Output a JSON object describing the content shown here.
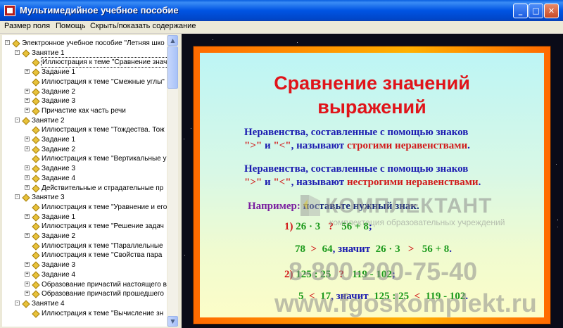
{
  "window": {
    "title": "Мультимедийное учебное пособие",
    "controls": {
      "minimize": "_",
      "maximize": "□",
      "close": "✕"
    }
  },
  "menu": [
    "Размер поля",
    "Помощь",
    "Скрыть/показать содержание"
  ],
  "tree": [
    {
      "level": 0,
      "expander": "-",
      "label": "Электронное учебное пособие \"Летняя шко"
    },
    {
      "level": 1,
      "expander": "-",
      "label": "Занятие 1"
    },
    {
      "level": 2,
      "expander": "",
      "label": "Иллюстрация к теме \"Сравнение знач",
      "selected": true
    },
    {
      "level": 2,
      "expander": "+",
      "label": "Задание 1"
    },
    {
      "level": 2,
      "expander": "",
      "label": "Иллюстрация к теме \"Смежные углы\""
    },
    {
      "level": 2,
      "expander": "+",
      "label": "Задание 2"
    },
    {
      "level": 2,
      "expander": "+",
      "label": "Задание 3"
    },
    {
      "level": 2,
      "expander": "+",
      "label": "Причастие как часть речи"
    },
    {
      "level": 1,
      "expander": "-",
      "label": "Занятие 2"
    },
    {
      "level": 2,
      "expander": "",
      "label": "Иллюстрация к теме \"Тождества. Тож"
    },
    {
      "level": 2,
      "expander": "+",
      "label": "Задание 1"
    },
    {
      "level": 2,
      "expander": "+",
      "label": "Задание 2"
    },
    {
      "level": 2,
      "expander": "",
      "label": "Иллюстрация к теме \"Вертикальные у"
    },
    {
      "level": 2,
      "expander": "+",
      "label": "Задание 3"
    },
    {
      "level": 2,
      "expander": "+",
      "label": "Задание 4"
    },
    {
      "level": 2,
      "expander": "+",
      "label": "Действительные и страдательные пр"
    },
    {
      "level": 1,
      "expander": "-",
      "label": "Занятие 3"
    },
    {
      "level": 2,
      "expander": "",
      "label": "Иллюстрация к теме \"Уравнение и его"
    },
    {
      "level": 2,
      "expander": "+",
      "label": "Задание 1"
    },
    {
      "level": 2,
      "expander": "",
      "label": "Иллюстрация к теме \"Решение задач"
    },
    {
      "level": 2,
      "expander": "+",
      "label": "Задание 2"
    },
    {
      "level": 2,
      "expander": "",
      "label": "Иллюстрация к теме \"Параллельные"
    },
    {
      "level": 2,
      "expander": "",
      "label": "Иллюстрация к теме \"Свойства пара"
    },
    {
      "level": 2,
      "expander": "+",
      "label": "Задание 3"
    },
    {
      "level": 2,
      "expander": "+",
      "label": "Задание 4"
    },
    {
      "level": 2,
      "expander": "+",
      "label": "Образование причастий настоящего в"
    },
    {
      "level": 2,
      "expander": "+",
      "label": "Образование причастий прошедшего"
    },
    {
      "level": 1,
      "expander": "-",
      "label": "Занятие 4"
    },
    {
      "level": 2,
      "expander": "",
      "label": "Иллюстрация к теме \"Вычисление зн"
    }
  ],
  "slide": {
    "title_line1": "Сравнение значений",
    "title_line2": "выражений",
    "p1_line1": "Неравенства, составленные с помощью знаков",
    "p1_gt": "\">\"",
    "p1_and": " и ",
    "p1_lt": "\"<\"",
    "p1_called": ", называют ",
    "p1_term": "строгими неравенствами",
    "p1_dot": ".",
    "p2_line1": "Неравенства, составленные с помощью знаков",
    "p2_ge": "\">\"",
    "p2_and": " и ",
    "p2_le": "\"<\"",
    "p2_called": ", называют ",
    "p2_term": "нестрогими неравенствами",
    "p2_dot": ".",
    "example_label": "Например:",
    "example_text": "поставьте нужный знак.",
    "ex1_num": "1)",
    "ex1_a": "26 · 3",
    "ex1_q": "?",
    "ex1_b": "56 + 8",
    "ex1_semi": ";",
    "ex1_ans_a": "78",
    "ex1_ans_sign": ">",
    "ex1_ans_b": "64",
    "ex1_so": ", значит",
    "ex1_ans_c": "26 · 3",
    "ex1_ans_sign2": ">",
    "ex1_ans_d": "56 + 8",
    "ex1_dot": ".",
    "ex2_num": "2)",
    "ex2_a": "125 : 25",
    "ex2_q": "?",
    "ex2_b": "119 - 102",
    "ex2_semi": ";",
    "ex2_ans_a": "5",
    "ex2_ans_sign": "<",
    "ex2_ans_b": "17",
    "ex2_so": ", значит",
    "ex2_ans_c": "125 : 25",
    "ex2_ans_sign2": "<",
    "ex2_ans_d": "119 - 102",
    "ex2_dot": "."
  },
  "watermark": {
    "brand": "КОМПЛЕКТАНТ",
    "tagline": "комплектация образовательных учреждений",
    "phone": "8-800-200-75-40",
    "site": "www.fgoskomplekt.ru"
  },
  "colors": {
    "title_red": "#E0141A",
    "text_blue": "#1B1BB0",
    "term_red": "#D11A1A",
    "num_green": "#1C9A1C",
    "example_purple": "#7A1FA0",
    "frame_orange": "#FF9A00"
  }
}
